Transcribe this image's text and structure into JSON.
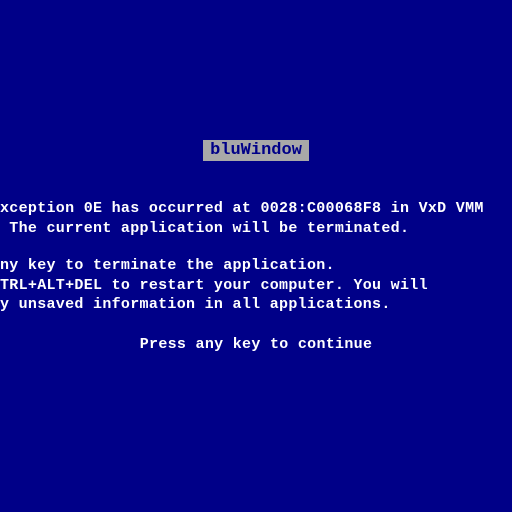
{
  "title": "bluWindow",
  "error": {
    "line1": "xception 0E has occurred at 0028:C00068F8 in VxD VMM",
    "line2": " The current application will be terminated."
  },
  "instructions": {
    "line1": "ny key to terminate the application.",
    "line2": "TRL+ALT+DEL to restart your computer. You will",
    "line3": "y unsaved information in all applications."
  },
  "continue": "Press any key to continue"
}
